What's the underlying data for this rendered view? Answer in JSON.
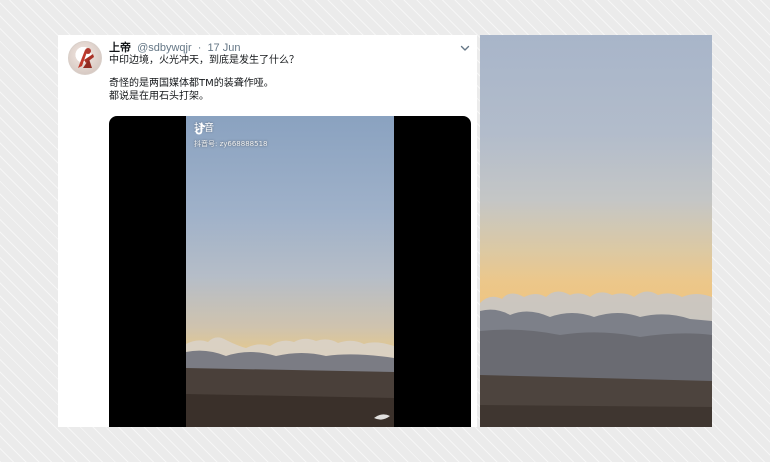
{
  "tweet": {
    "display_name": "上帝",
    "handle": "@sdbywqjr",
    "separator": "·",
    "date": "17 Jun",
    "text_lines": [
      "中印边境，火光冲天，到底是发生了什么？",
      "",
      "奇怪的是两国媒体都TM的装聋作哑。",
      "都说是在用石头打架。"
    ]
  },
  "video": {
    "watermark_app": "抖音",
    "watermark_id": "抖音号: zy668888518"
  },
  "icons": {
    "avatar": "avatar-image",
    "menu": "chevron-down-icon",
    "watermark": "tiktok-logo-icon"
  },
  "colors": {
    "name_text": "#14171a",
    "meta_text": "#657786",
    "video_bg": "#000000",
    "background": "#ebebeb"
  }
}
